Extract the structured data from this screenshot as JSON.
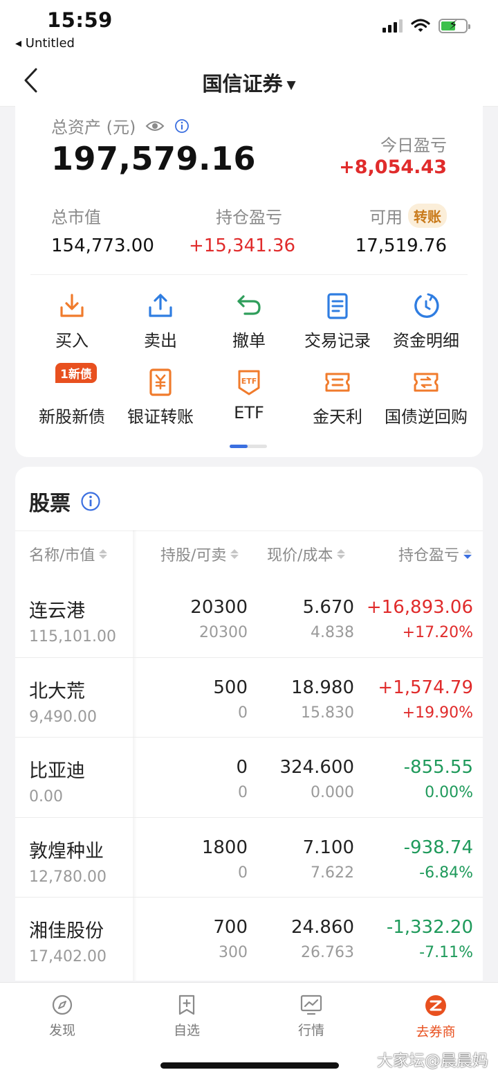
{
  "status_bar": {
    "time": "15:59",
    "back_app": "Untitled"
  },
  "nav": {
    "title": "国信证券"
  },
  "account": {
    "total_label": "总资产 (元)",
    "total_value": "197,579.16",
    "today_label": "今日盈亏",
    "today_value": "+8,054.43",
    "market_value_label": "总市值",
    "market_value": "154,773.00",
    "holding_pnl_label": "持仓盈亏",
    "holding_pnl": "+15,341.36",
    "available_label": "可用",
    "transfer_badge": "转账",
    "available": "17,519.76"
  },
  "actions_row1": [
    {
      "label": "买入",
      "icon": "download-icon"
    },
    {
      "label": "卖出",
      "icon": "upload-icon"
    },
    {
      "label": "撤单",
      "icon": "undo-icon"
    },
    {
      "label": "交易记录",
      "icon": "document-icon"
    },
    {
      "label": "资金明细",
      "icon": "cycle-icon"
    }
  ],
  "actions_row2": [
    {
      "label": "新股新债",
      "icon": "new-stock-icon",
      "badge": "1新债"
    },
    {
      "label": "银证转账",
      "icon": "yuan-icon"
    },
    {
      "label": "ETF",
      "icon": "etf-icon"
    },
    {
      "label": "金天利",
      "icon": "ticket-icon"
    },
    {
      "label": "国债逆回购",
      "icon": "repo-icon"
    }
  ],
  "colors": {
    "up": "#e02b2b",
    "down": "#1f9a5b",
    "accent_orange": "#e8501f",
    "accent_blue": "#3b6fe0",
    "accent_green": "#2f9e5b"
  },
  "stocks": {
    "title": "股票",
    "headers": {
      "name": "名称/市值",
      "hold": "持股/可卖",
      "price": "现价/成本",
      "pnl": "持仓盈亏"
    },
    "rows": [
      {
        "name": "连云港",
        "market_value": "115,101.00",
        "hold": "20300",
        "sellable": "20300",
        "price": "5.670",
        "cost": "4.838",
        "pnl": "+16,893.06",
        "pnl_pct": "+17.20%"
      },
      {
        "name": "北大荒",
        "market_value": "9,490.00",
        "hold": "500",
        "sellable": "0",
        "price": "18.980",
        "cost": "15.830",
        "pnl": "+1,574.79",
        "pnl_pct": "+19.90%"
      },
      {
        "name": "比亚迪",
        "market_value": "0.00",
        "hold": "0",
        "sellable": "0",
        "price": "324.600",
        "cost": "0.000",
        "pnl": "-855.55",
        "pnl_pct": "0.00%"
      },
      {
        "name": "敦煌种业",
        "market_value": "12,780.00",
        "hold": "1800",
        "sellable": "0",
        "price": "7.100",
        "cost": "7.622",
        "pnl": "-938.74",
        "pnl_pct": "-6.84%"
      },
      {
        "name": "湘佳股份",
        "market_value": "17,402.00",
        "hold": "700",
        "sellable": "300",
        "price": "24.860",
        "cost": "26.763",
        "pnl": "-1,332.20",
        "pnl_pct": "-7.11%"
      }
    ]
  },
  "tabs": [
    {
      "label": "发现",
      "icon": "compass-icon"
    },
    {
      "label": "自选",
      "icon": "bookmark-plus-icon"
    },
    {
      "label": "行情",
      "icon": "chart-monitor-icon"
    },
    {
      "label": "去券商",
      "icon": "broker-logo-icon"
    }
  ],
  "watermark": "大家坛@晨晨妈"
}
